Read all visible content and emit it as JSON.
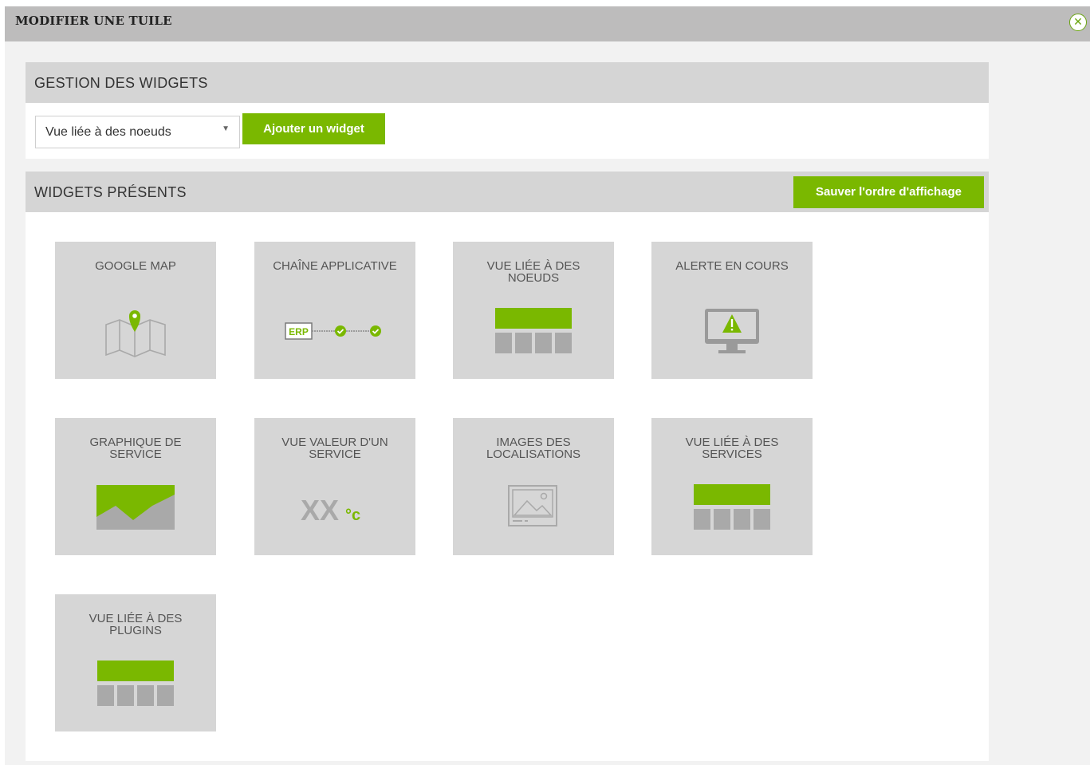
{
  "window": {
    "title": "MODIFIER UNE TUILE",
    "close_icon": "close-circle-icon"
  },
  "manage": {
    "title": "GESTION DES WIDGETS",
    "select_value": "Vue liée à des noeuds",
    "add_button": "Ajouter un widget"
  },
  "present": {
    "title": "WIDGETS PRÉSENTS",
    "save_button": "Sauver l'ordre d'affichage",
    "tiles": [
      {
        "label": "GOOGLE MAP",
        "icon": "map-pin-icon"
      },
      {
        "label": "CHAÎNE APPLICATIVE",
        "icon": "erp-chain-icon",
        "icon_text": "ERP"
      },
      {
        "label": "VUE LIÉE À DES NOEUDS",
        "icon": "table-view-icon"
      },
      {
        "label": "ALERTE EN COURS",
        "icon": "monitor-alert-icon"
      },
      {
        "label": "GRAPHIQUE DE SERVICE",
        "icon": "area-chart-icon"
      },
      {
        "label": "VUE VALEUR D'UN SERVICE",
        "icon": "value-icon",
        "icon_text": "XX",
        "unit": "°c"
      },
      {
        "label": "IMAGES DES LOCALISATIONS",
        "icon": "image-icon"
      },
      {
        "label": "VUE LIÉE À DES SERVICES",
        "icon": "table-view-icon"
      },
      {
        "label": "VUE LIÉE À DES PLUGINS",
        "icon": "table-view-icon"
      }
    ]
  },
  "colors": {
    "accent": "#7ab800",
    "titlebar": "#bdbcbc",
    "panel_head": "#d5d5d5",
    "tile": "#d6d6d6",
    "icon_grey": "#a9a9a9"
  }
}
